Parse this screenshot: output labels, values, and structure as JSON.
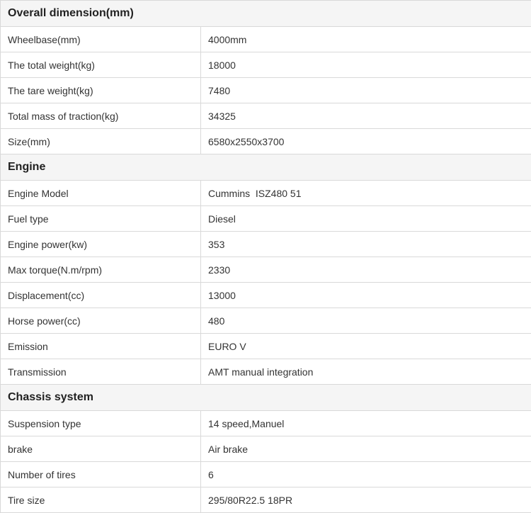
{
  "sections": [
    {
      "title": "Overall dimension(mm)",
      "rows": [
        {
          "label": "Wheelbase(mm)",
          "value": "4000mm"
        },
        {
          "label": "The total weight(kg)",
          "value": "18000"
        },
        {
          "label": "The tare weight(kg)",
          "value": "7480"
        },
        {
          "label": "Total mass of traction(kg)",
          "value": "34325"
        },
        {
          "label": "Size(mm)",
          "value": "6580x2550x3700"
        }
      ]
    },
    {
      "title": "Engine",
      "rows": [
        {
          "label": "Engine Model",
          "value": "Cummins  ISZ480 51"
        },
        {
          "label": "Fuel type",
          "value": "Diesel"
        },
        {
          "label": "Engine power(kw)",
          "value": "353"
        },
        {
          "label": "Max torque(N.m/rpm)",
          "value": "2330"
        },
        {
          "label": "Displacement(cc)",
          "value": "13000"
        },
        {
          "label": "Horse power(cc)",
          "value": "480"
        },
        {
          "label": "Emission",
          "value": "EURO V"
        },
        {
          "label": "Transmission",
          "value": "AMT manual integration"
        }
      ]
    },
    {
      "title": "Chassis system",
      "rows": [
        {
          "label": "Suspension type",
          "value": "14 speed,Manuel"
        },
        {
          "label": "brake",
          "value": "Air brake"
        },
        {
          "label": "Number of tires",
          "value": "6"
        },
        {
          "label": "Tire size",
          "value": "295/80R22.5 18PR"
        }
      ]
    }
  ]
}
